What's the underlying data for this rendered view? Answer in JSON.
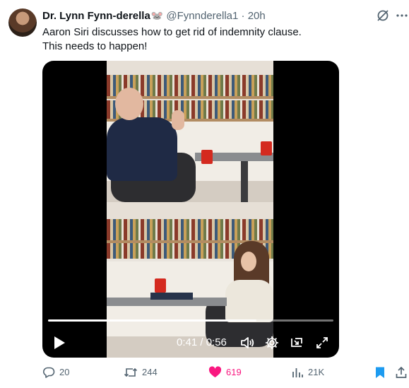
{
  "author": {
    "display_name": "Dr. Lynn Fynn-derella",
    "emoji": "🐭",
    "handle": "@Fynnderella1",
    "separator": "·",
    "time": "20h"
  },
  "tweet": {
    "lines": [
      "Aaron Siri discusses how to get rid of indemnity clause.",
      "This needs to happen!"
    ]
  },
  "video": {
    "time_display": "0:41 / 0:56",
    "progress": 0.73
  },
  "actions": {
    "replies": "20",
    "reposts": "244",
    "likes": "619",
    "views": "21K"
  },
  "colors": {
    "like_active": "#f91880",
    "bookmark_active": "#1d9bf0",
    "muted_text": "#536471"
  }
}
